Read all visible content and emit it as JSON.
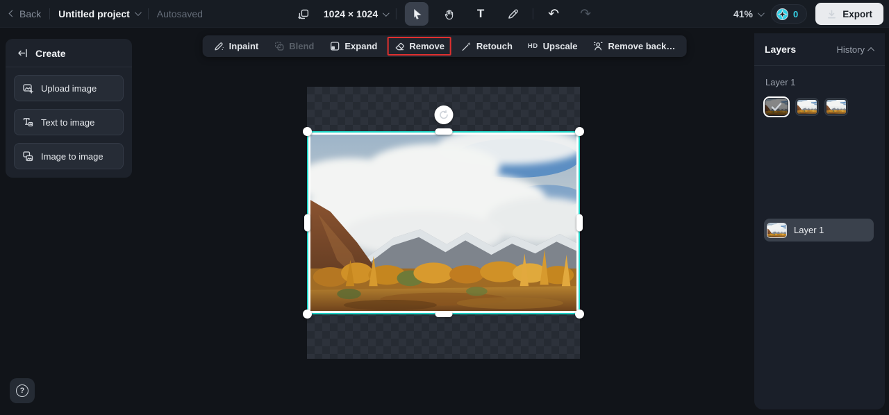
{
  "topbar": {
    "back_label": "Back",
    "project_name": "Untitled project",
    "autosaved": "Autosaved",
    "size_label": "1024 × 1024",
    "zoom_label": "41%",
    "credits": "0",
    "export_label": "Export"
  },
  "icons": {
    "text_tool": "T",
    "undo": "↶",
    "redo": "↷",
    "help": "?"
  },
  "action_toolbar": {
    "items": [
      {
        "label": "Inpaint"
      },
      {
        "label": "Blend",
        "disabled": true
      },
      {
        "label": "Expand"
      },
      {
        "label": "Remove",
        "highlighted": true
      },
      {
        "label": "Retouch"
      },
      {
        "label": "Upscale",
        "prefix": "HD"
      },
      {
        "label": "Remove back…"
      }
    ]
  },
  "sidebar": {
    "title": "Create",
    "items": [
      {
        "label": "Upload image"
      },
      {
        "label": "Text to image"
      },
      {
        "label": "Image to image"
      }
    ]
  },
  "layers_panel": {
    "layers_tab": "Layers",
    "history_tab": "History",
    "group_label": "Layer 1",
    "layer_item_label": "Layer 1"
  },
  "colors": {
    "accent_teal": "#1ed4c7",
    "highlight_red": "#e1302f",
    "credits_cyan": "#35d3e8",
    "export_button_bg": "#e9ebee"
  }
}
